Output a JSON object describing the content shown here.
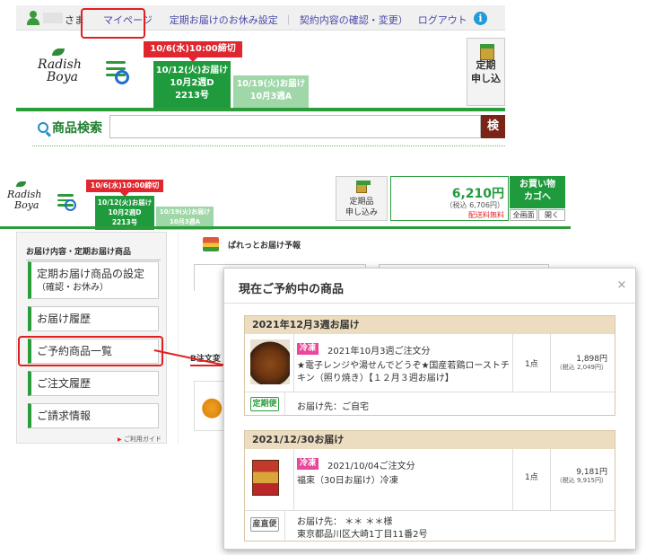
{
  "top": {
    "greeting": "さま",
    "nav": {
      "mypage": "マイページ",
      "holiday": "定期お届けのお休み設定",
      "contract": "契約内容の確認・変更）",
      "logout": "ログアウト",
      "sep": "｜"
    },
    "info_icon": "i",
    "logo_line1": "Radish",
    "logo_line2": "Boya",
    "deadline": "10/6(水)10:00締切",
    "tab_active": {
      "line1": "10/12(火)お届け",
      "line2": "10月2週D",
      "line3": "2213号"
    },
    "tab_inactive": {
      "line1": "10/19(火)お届け",
      "line2": "10月3週A"
    },
    "teiki_btn": {
      "line1": "定期",
      "line2": "申し込"
    },
    "search_label": "商品検索",
    "search_btn": "検"
  },
  "bottom": {
    "logo_line1": "Radish",
    "logo_line2": "Boya",
    "deadline": "10/6(水)10:00締切",
    "tab_active": {
      "line1": "10/12(火)お届け",
      "line2": "10月2週D",
      "line3": "2213号"
    },
    "tab_inactive": {
      "line1": "10/19(火)お届け",
      "line2": "10月3週A"
    },
    "teiki_btn": {
      "line1": "定期品",
      "line2": "申し込み"
    },
    "price": "6,210円",
    "price_tax": "（税込 6,706円）",
    "shipping_note": "配送料無料",
    "cart_btn": {
      "line1": "お買い物",
      "line2": "カゴへ"
    },
    "view_full": "全画面",
    "view_open": "開く",
    "section_head": "お届け内容・定期お届け商品",
    "sidebar": {
      "item1_line1": "定期お届け商品の設定",
      "item1_line2": "（確認・お休み）",
      "item2": "お届け履歴",
      "item3": "ご予約商品一覧",
      "item4": "ご注文履歴",
      "item5": "ご請求情報"
    },
    "guide": "ご利用ガイド",
    "paretto": "ぱれっとお届け予報",
    "order_label": "B注文変"
  },
  "popup": {
    "title": "現在ご予約中の商品",
    "close": "×",
    "groups": [
      {
        "head": "2021年12月3週お届け",
        "badge": "冷凍",
        "order_date": "2021年10月3週ご注文分",
        "name_line1": "★電子レンジや湯せんでどうぞ★国産若鶏ローストチ",
        "name_line2": "キン（照り焼き）【１２月３週お届け】",
        "qty": "1点",
        "price": "1,898円",
        "price_tax": "（税込 2,049円）",
        "delivery_badge": "定期便",
        "address_line1": "お届け先：ご自宅",
        "address_line2": ""
      },
      {
        "head": "2021/12/30お届け",
        "badge": "冷凍",
        "order_date": "2021/10/04ご注文分",
        "name_line1": "福束（30日お届け）冷凍",
        "name_line2": "",
        "qty": "1点",
        "price": "9,181円",
        "price_tax": "（税込 9,915円）",
        "delivery_badge": "産直便",
        "address_line1": "お届け先： ＊＊ ＊＊様",
        "address_line2": "東京都品川区大崎1丁目11番2号"
      }
    ]
  },
  "colors": {
    "brand_green": "#1f9b3e",
    "deadline_red": "#e0262e",
    "highlight_red": "#e02020",
    "frozen_pink": "#e8479b",
    "group_tan": "#ecdcc0"
  }
}
